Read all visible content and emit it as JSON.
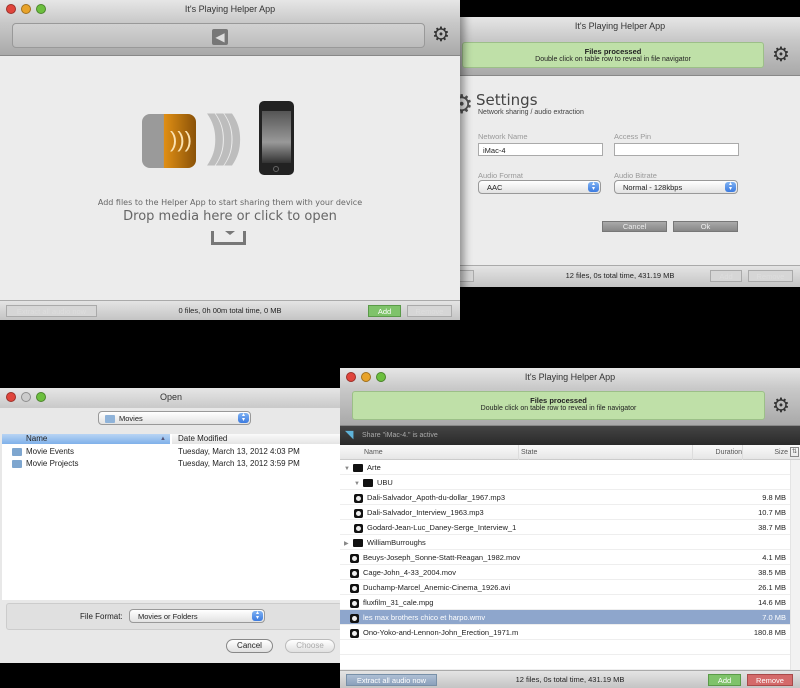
{
  "colors": {
    "green_banner": "#bfe0a8",
    "add_green": "#7fc36a",
    "remove_red": "#d46a6a",
    "selection": "#8ea6cc",
    "accent_blue": "#3c7be0"
  },
  "main_window": {
    "title": "It's Playing Helper App",
    "tagline": "Add files to the Helper App to start sharing them with your device",
    "drop_text": "Drop media here or click to open",
    "extract_label": "Extract all audio now",
    "status": "0 files, 0h 00m total time, 0 MB",
    "add_label": "Add",
    "remove_label": "Remove"
  },
  "settings_window": {
    "title": "It's Playing Helper App",
    "banner_title": "Files processed",
    "banner_text": "Double click on table row to reveal in file navigator",
    "heading": "Settings",
    "subheading": "Network sharing / audio extraction",
    "network_name_label": "Network Name",
    "network_name_value": "iMac-4",
    "access_pin_label": "Access Pin",
    "access_pin_value": "",
    "audio_format_label": "Audio Format",
    "audio_format_value": "AAC",
    "audio_bitrate_label": "Audio Bitrate",
    "audio_bitrate_value": "Normal - 128kbps",
    "cancel_label": "Cancel",
    "ok_label": "Ok",
    "status": "12 files, 0s total time, 431.19 MB",
    "extract_partial": "ow",
    "add_label": "Add",
    "remove_label": "Remove"
  },
  "open_dialog": {
    "title": "Open",
    "location": "Movies",
    "columns": [
      "Name",
      "Date Modified"
    ],
    "rows": [
      {
        "name": "Movie Events",
        "date": "Tuesday, March 13, 2012 4:03 PM"
      },
      {
        "name": "Movie Projects",
        "date": "Tuesday, March 13, 2012 3:59 PM"
      }
    ],
    "file_format_label": "File Format:",
    "file_format_value": "Movies or Folders",
    "cancel_label": "Cancel",
    "choose_label": "Choose"
  },
  "list_window": {
    "title": "It's Playing Helper App",
    "banner_title": "Files processed",
    "banner_text": "Double click on table row to reveal in file navigator",
    "share_status": "Share \"iMac-4.\" is active",
    "columns": [
      "Name",
      "State",
      "Duration",
      "Size"
    ],
    "rows": [
      {
        "name": "Arte",
        "type": "folder",
        "level": 0,
        "expanded": true,
        "size": ""
      },
      {
        "name": "UBU",
        "type": "folder",
        "level": 1,
        "expanded": true,
        "size": ""
      },
      {
        "name": "Dali-Salvador_Apoth-du-dollar_1967.mp3",
        "type": "audio",
        "level": 2,
        "size": "9.8 MB"
      },
      {
        "name": "Dali-Salvador_Interview_1963.mp3",
        "type": "audio",
        "level": 2,
        "size": "10.7 MB"
      },
      {
        "name": "Godard-Jean-Luc_Daney-Serge_Interview_1",
        "type": "audio",
        "level": 2,
        "size": "38.7 MB"
      },
      {
        "name": "WilliamBurroughs",
        "type": "folder",
        "level": 0,
        "expanded": false,
        "size": ""
      },
      {
        "name": "Beuys-Joseph_Sonne-Statt-Reagan_1982.mov",
        "type": "video",
        "level": 1,
        "size": "4.1 MB"
      },
      {
        "name": "Cage-John_4-33_2004.mov",
        "type": "video",
        "level": 1,
        "size": "38.5 MB"
      },
      {
        "name": "Duchamp-Marcel_Anemic-Cinema_1926.avi",
        "type": "video",
        "level": 1,
        "size": "26.1 MB"
      },
      {
        "name": "fluxfilm_31_cale.mpg",
        "type": "video",
        "level": 1,
        "size": "14.6 MB"
      },
      {
        "name": "les max brothers chico et harpo.wmv",
        "type": "video",
        "level": 1,
        "size": "7.0 MB",
        "selected": true
      },
      {
        "name": "Ono-Yoko-and-Lennon-John_Erection_1971.m",
        "type": "video",
        "level": 1,
        "size": "180.8 MB"
      }
    ],
    "extract_label": "Extract all audio now",
    "status": "12 files, 0s total time, 431.19 MB",
    "add_label": "Add",
    "remove_label": "Remove"
  }
}
